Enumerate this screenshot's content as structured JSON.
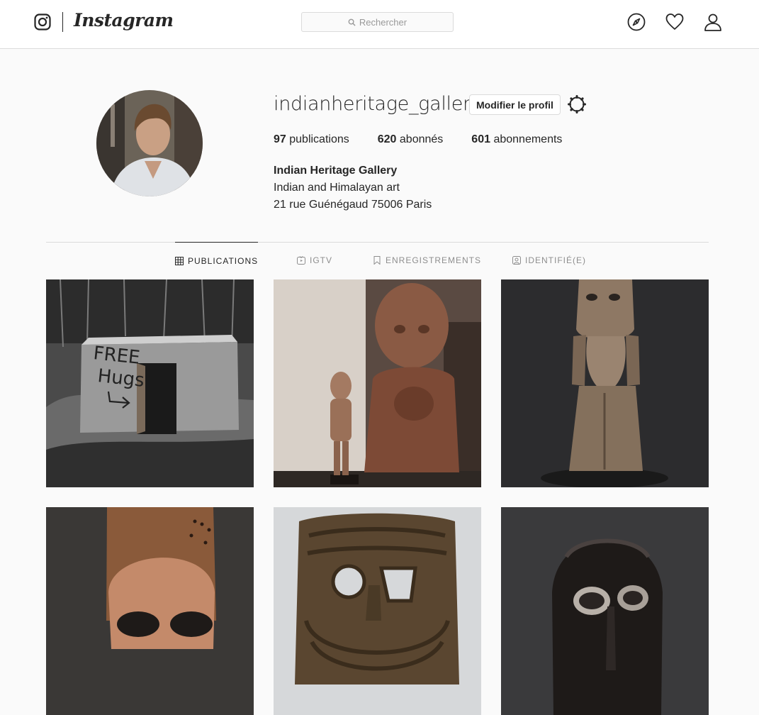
{
  "header": {
    "logo_icon": "instagram-camera-icon",
    "wordmark": "Instagram",
    "search_placeholder": "Rechercher",
    "nav_icons": [
      "compass-icon",
      "heart-icon",
      "user-icon"
    ]
  },
  "profile": {
    "username": "indianheritage_gallery",
    "edit_button": "Modifier le profil",
    "settings_icon": "gear-icon",
    "stats": {
      "posts_count": "97",
      "posts_label": "publications",
      "followers_count": "620",
      "followers_label": "abonnés",
      "following_count": "601",
      "following_label": "abonnements"
    },
    "bio": {
      "name": "Indian Heritage Gallery",
      "line1": "Indian and Himalayan art",
      "line2": "21 rue Guénégaud 75006 Paris"
    }
  },
  "tabs": [
    {
      "label": "PUBLICATIONS",
      "icon": "grid-icon",
      "active": true
    },
    {
      "label": "IGTV",
      "icon": "tv-icon",
      "active": false
    },
    {
      "label": "ENREGISTREMENTS",
      "icon": "bookmark-icon",
      "active": false
    },
    {
      "label": "IDENTIFIÉ(E)",
      "icon": "tagged-icon",
      "active": false
    }
  ],
  "posts": [
    {
      "alt": "Free Hugs"
    },
    {
      "alt": "stone figures"
    },
    {
      "alt": "wooden figure"
    },
    {
      "alt": "painted mask"
    },
    {
      "alt": "carved mask"
    },
    {
      "alt": "dark mask"
    }
  ],
  "colors": {
    "background": "#fafafa",
    "border": "#dbdbdb",
    "text": "#262626",
    "muted": "#8e8e8e"
  }
}
